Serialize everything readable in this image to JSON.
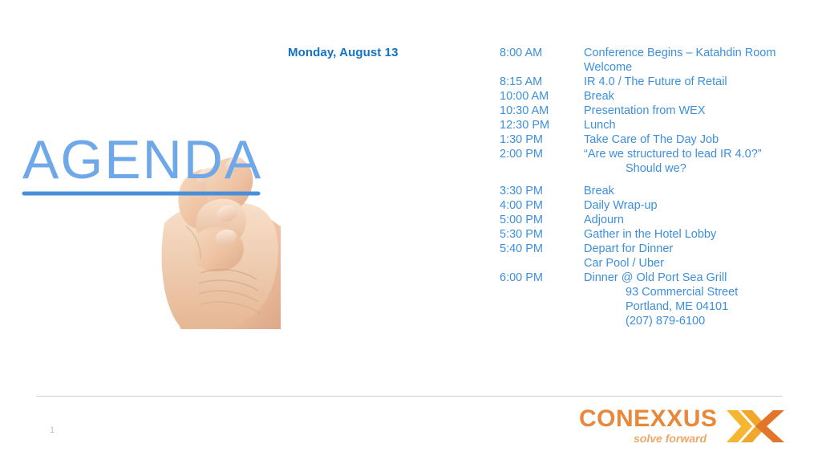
{
  "slide": {
    "page_number": "1"
  },
  "artwork": {
    "title_text": "AGENDA",
    "alt": "hand-drawing-agenda-image",
    "title_color": "#6fa8e8",
    "underline_color": "#4a90d9"
  },
  "day_heading": "Monday, August 13",
  "agenda": {
    "rows": [
      {
        "time": "8:00 AM",
        "desc": "Conference Begins – Katahdin Room",
        "indent": false,
        "spacer_before": false
      },
      {
        "time": "",
        "desc": "Welcome",
        "indent": false,
        "spacer_before": false
      },
      {
        "time": "8:15 AM",
        "desc": "IR 4.0 / The Future of Retail",
        "indent": false,
        "spacer_before": false
      },
      {
        "time": "10:00 AM",
        "desc": "Break",
        "indent": false,
        "spacer_before": false
      },
      {
        "time": "10:30 AM",
        "desc": "Presentation from WEX",
        "indent": false,
        "spacer_before": false
      },
      {
        "time": "12:30 PM",
        "desc": "Lunch",
        "indent": false,
        "spacer_before": false
      },
      {
        "time": "1:30 PM",
        "desc": "Take Care of The Day Job",
        "indent": false,
        "spacer_before": false
      },
      {
        "time": "2:00 PM",
        "desc": "“Are we structured to lead IR 4.0?”",
        "indent": false,
        "spacer_before": false
      },
      {
        "time": "",
        "desc": "Should we?",
        "indent": true,
        "spacer_before": false
      },
      {
        "time": "3:30 PM",
        "desc": "Break",
        "indent": false,
        "spacer_before": true
      },
      {
        "time": "4:00 PM",
        "desc": "Daily Wrap-up",
        "indent": false,
        "spacer_before": false
      },
      {
        "time": "5:00 PM",
        "desc": "Adjourn",
        "indent": false,
        "spacer_before": false
      },
      {
        "time": "5:30 PM",
        "desc": "Gather in the Hotel Lobby",
        "indent": false,
        "spacer_before": false
      },
      {
        "time": "5:40 PM",
        "desc": "Depart for Dinner",
        "indent": false,
        "spacer_before": false
      },
      {
        "time": "",
        "desc": "Car Pool / Uber",
        "indent": false,
        "spacer_before": false
      },
      {
        "time": "6:00 PM",
        "desc": "Dinner @ Old Port Sea Grill",
        "indent": false,
        "spacer_before": false
      },
      {
        "time": "",
        "desc": "93 Commercial Street",
        "indent": true,
        "spacer_before": false
      },
      {
        "time": "",
        "desc": "Portland, ME 04101",
        "indent": true,
        "spacer_before": false
      },
      {
        "time": "",
        "desc": "(207) 879-6100",
        "indent": true,
        "spacer_before": false
      }
    ]
  },
  "logo": {
    "wordmark": "CONEXXUS",
    "tagline": "solve forward",
    "mark_name": "conexxus-chevron-x-mark",
    "wordmark_color": "#e8883a",
    "tagline_color": "#eda867",
    "mark_color_light": "#f5b731",
    "mark_color_dark": "#e2752c"
  },
  "colors": {
    "heading_blue": "#1272c4",
    "body_blue": "#3d8fdd",
    "rule_gray": "#d2cec9",
    "page_number_gray": "#c3bfbb"
  }
}
